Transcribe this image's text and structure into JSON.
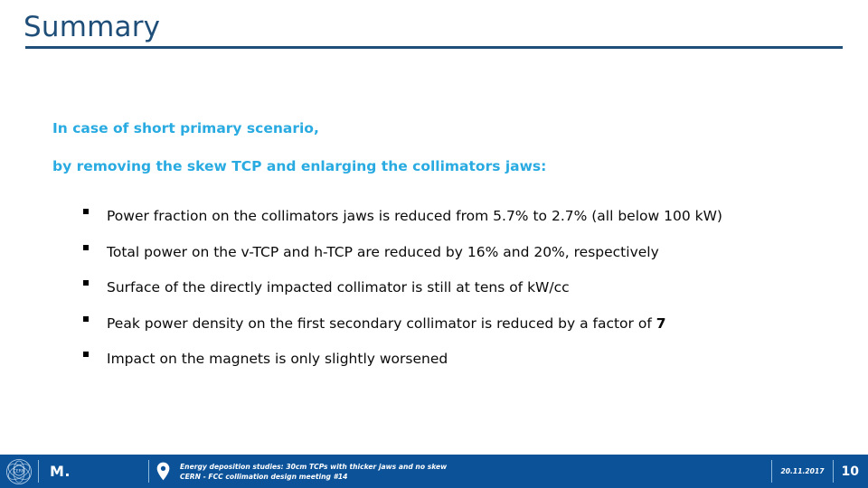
{
  "slide": {
    "title": "Summary",
    "accent_color": "#29ABE2",
    "title_color": "#1F4E79",
    "footer_color": "#0B5299"
  },
  "intro": {
    "line1": "In case of short primary scenario,",
    "line2": "by removing the skew TCP and enlarging the collimators jaws:"
  },
  "bullets": [
    {
      "marker": "square-bullet",
      "text": "Power fraction on the collimators jaws is reduced from 5.7% to 2.7% (all below 100 kW)",
      "bold_tail": ""
    },
    {
      "marker": "square-bullet",
      "text": "Total power on the v-TCP and h-TCP are reduced by 16% and 20%, respectively",
      "bold_tail": ""
    },
    {
      "marker": "square-bullet",
      "text": "Surface of the directly impacted collimator is still at tens of kW/cc",
      "bold_tail": ""
    },
    {
      "marker": "square-bullet",
      "text": "Peak power density on the first secondary collimator is reduced by a factor of ",
      "bold_tail": "7"
    },
    {
      "marker": "square-bullet",
      "text": "Impact on the magnets is only slightly worsened",
      "bold_tail": ""
    }
  ],
  "footer": {
    "logo_name": "cern-logo",
    "author": "M.",
    "pin_icon": "location-pin-icon",
    "meeting_line1": "Energy deposition studies: 30cm TCPs with thicker jaws and no skew",
    "meeting_line2": "CERN - FCC collimation design meeting #14",
    "date": "20.11.2017",
    "page_number": "10"
  }
}
